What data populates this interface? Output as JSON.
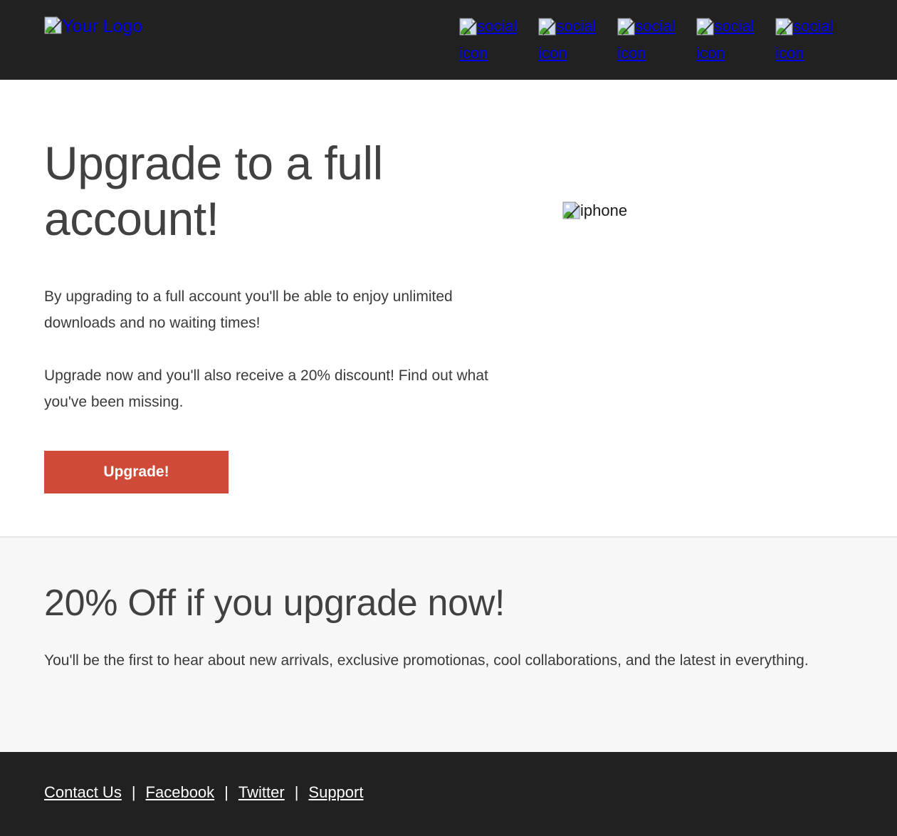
{
  "colors": {
    "header_bg": "#212121",
    "footer_bg": "#212121",
    "promo_bg": "#f7f7f7",
    "page_bg": "#ffffff",
    "cta_red": "#cf4a38",
    "link_blue": "#0000ee",
    "heading_gray": "#414141",
    "body_gray": "#3a3a3a",
    "divider_gray": "#e8e8e8"
  },
  "header": {
    "logo": {
      "icon": "broken-image-icon",
      "alt_text": "Your Logo"
    },
    "social_links": [
      {
        "icon": "broken-image-icon",
        "alt_text": "social icon"
      },
      {
        "icon": "broken-image-icon",
        "alt_text": "social icon"
      },
      {
        "icon": "broken-image-icon",
        "alt_text": "social icon"
      },
      {
        "icon": "broken-image-icon",
        "alt_text": "social icon"
      },
      {
        "icon": "broken-image-icon",
        "alt_text": "social icon"
      }
    ]
  },
  "hero": {
    "title": "Upgrade to a full account!",
    "paragraph_1": "By upgrading to a full account you'll be able to enjoy unlimited downloads and no waiting times!",
    "paragraph_2": "Upgrade now and you'll also receive a 20% discount! Find out what you've been missing.",
    "cta_label": "Upgrade!",
    "figure": {
      "icon": "broken-image-icon",
      "alt_text": "iphone"
    }
  },
  "promo": {
    "title": "20% Off if you upgrade now!",
    "paragraph": "You'll be the first to hear about new arrivals, exclusive promotionas, cool collaborations, and the latest in everything."
  },
  "footer": {
    "separator": "|",
    "links": [
      {
        "label": "Contact Us"
      },
      {
        "label": "Facebook"
      },
      {
        "label": "Twitter"
      },
      {
        "label": "Support"
      }
    ]
  }
}
